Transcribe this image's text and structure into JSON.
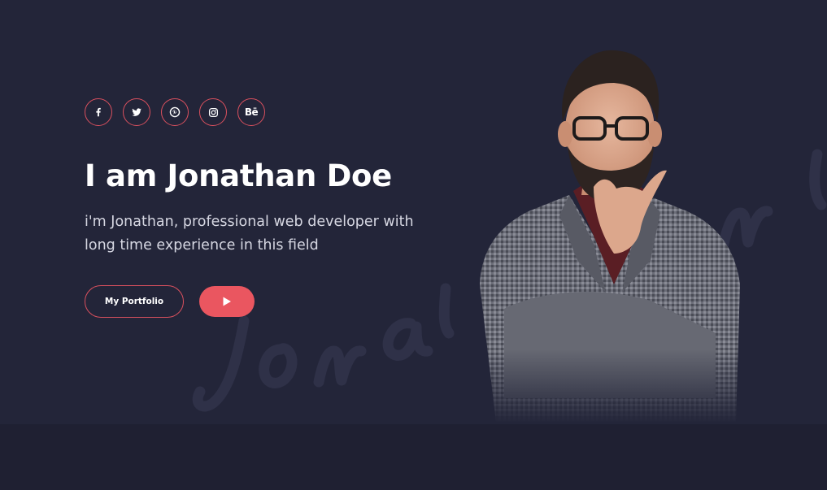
{
  "hero": {
    "title": "I am Jonathan Doe",
    "subtitle_line1": "i'm Jonathan, professional web developer with",
    "subtitle_line2": "long time experience in this field",
    "watermark_text": "Jonathan"
  },
  "socials": [
    {
      "name": "facebook-icon",
      "glyph": "f"
    },
    {
      "name": "twitter-icon",
      "glyph": "twitter"
    },
    {
      "name": "pinterest-icon",
      "glyph": "pinterest"
    },
    {
      "name": "instagram-icon",
      "glyph": "instagram"
    },
    {
      "name": "behance-icon",
      "glyph": "Bē"
    }
  ],
  "buttons": {
    "portfolio_label": "My Portfolio",
    "play_icon": "play-icon"
  },
  "colors": {
    "background": "#232539",
    "accent": "#ea5660",
    "text": "#ffffff",
    "muted_text": "#d6d7e2"
  }
}
